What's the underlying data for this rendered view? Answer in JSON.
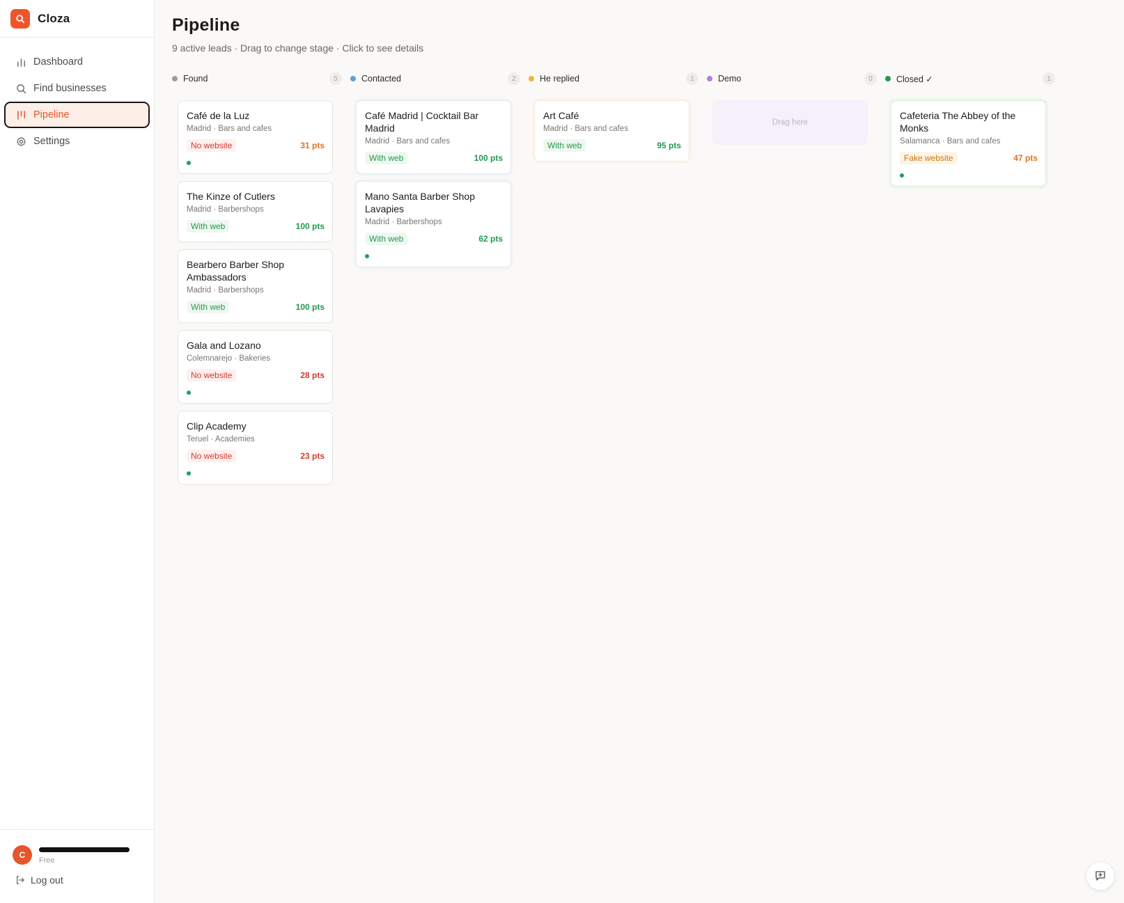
{
  "app": {
    "name": "Cloza",
    "logo_icon": "search-icon",
    "accent": "#f0552a"
  },
  "sidebar": {
    "items": [
      {
        "label": "Dashboard",
        "icon": "bar-chart-icon",
        "active": false
      },
      {
        "label": "Find businesses",
        "icon": "search-icon",
        "active": false
      },
      {
        "label": "Pipeline",
        "icon": "kanban-icon",
        "active": true
      },
      {
        "label": "Settings",
        "icon": "gear-icon",
        "active": false
      }
    ],
    "user": {
      "initial": "C",
      "plan": "Free"
    },
    "logout_label": "Log out"
  },
  "page": {
    "title": "Pipeline",
    "subtitle": "9 active leads · Drag to change stage · Click to see details"
  },
  "columns": [
    {
      "name": "Found",
      "count": "5",
      "color": "#a19c96",
      "stage": "found",
      "cards": [
        {
          "title": "Café de la Luz",
          "meta": "Madrid · Bars and cafes",
          "badge": "No website",
          "badge_type": "nosite",
          "pts": "31 pts",
          "pts_color": "orange",
          "dot": true
        },
        {
          "title": "The Kinze of Cutlers",
          "meta": "Madrid · Barbershops",
          "badge": "With web",
          "badge_type": "web",
          "pts": "100 pts",
          "pts_color": "green",
          "dot": false
        },
        {
          "title": "Bearbero Barber Shop Ambassadors",
          "meta": "Madrid · Barbershops",
          "badge": "With web",
          "badge_type": "web",
          "pts": "100 pts",
          "pts_color": "green",
          "dot": false
        },
        {
          "title": "Gala and Lozano",
          "meta": "Colemnarejo · Bakeries",
          "badge": "No website",
          "badge_type": "nosite",
          "pts": "28 pts",
          "pts_color": "red",
          "dot": true
        },
        {
          "title": "Clip Academy",
          "meta": "Teruel · Academies",
          "badge": "No website",
          "badge_type": "nosite",
          "pts": "23 pts",
          "pts_color": "red",
          "dot": true
        }
      ]
    },
    {
      "name": "Contacted",
      "count": "2",
      "color": "#5aa0e0",
      "stage": "contacted",
      "cards": [
        {
          "title": "Café Madrid | Cocktail Bar Madrid",
          "meta": "Madrid · Bars and cafes",
          "badge": "With web",
          "badge_type": "web",
          "pts": "100 pts",
          "pts_color": "green",
          "dot": false
        },
        {
          "title": "Mano Santa Barber Shop Lavapies",
          "meta": "Madrid · Barbershops",
          "badge": "With web",
          "badge_type": "web",
          "pts": "62 pts",
          "pts_color": "green",
          "dot": true
        }
      ]
    },
    {
      "name": "He replied",
      "count": "1",
      "color": "#f2b43a",
      "stage": "replied",
      "cards": [
        {
          "title": "Art Café",
          "meta": "Madrid · Bars and cafes",
          "badge": "With web",
          "badge_type": "web",
          "pts": "95 pts",
          "pts_color": "green",
          "dot": false
        }
      ]
    },
    {
      "name": "Demo",
      "count": "0",
      "color": "#b57be6",
      "stage": "demo",
      "cards": [],
      "empty_label": "Drag here"
    },
    {
      "name": "Closed ✓",
      "count": "1",
      "color": "#23994f",
      "stage": "closed",
      "cards": [
        {
          "title": "Cafeteria The Abbey of the Monks",
          "meta": "Salamanca · Bars and cafes",
          "badge": "Fake website",
          "badge_type": "fake",
          "pts": "47 pts",
          "pts_color": "orange",
          "dot": true
        }
      ]
    }
  ],
  "feedback": {
    "icon": "message-plus-icon"
  }
}
